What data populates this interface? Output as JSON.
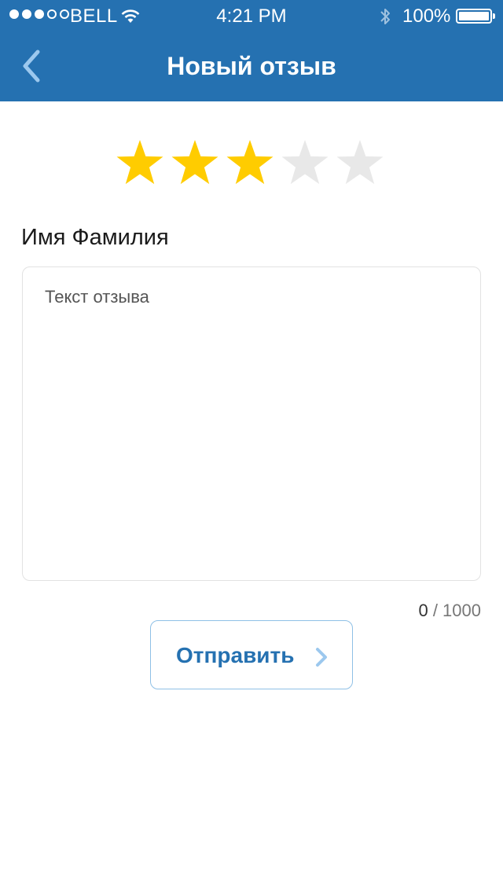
{
  "status_bar": {
    "carrier": "BELL",
    "time": "4:21 PM",
    "battery_percent": "100%",
    "battery_level": 1.0,
    "signal_bars_filled": 3,
    "signal_bars_total": 5
  },
  "nav": {
    "title": "Новый отзыв",
    "back_icon": "chevron-left-icon"
  },
  "rating": {
    "value": 3,
    "max": 5,
    "filled_color": "#ffcc00",
    "empty_color": "#e8e8e8"
  },
  "form": {
    "name_value": "Имя Фамилия",
    "review_placeholder": "Текст отзыва",
    "char_count": "0",
    "char_separator": " / ",
    "char_limit": "1000"
  },
  "submit": {
    "label": "Отправить",
    "icon": "chevron-right-icon"
  },
  "colors": {
    "accent": "#2571b1",
    "button_border": "#8fc0e6"
  }
}
